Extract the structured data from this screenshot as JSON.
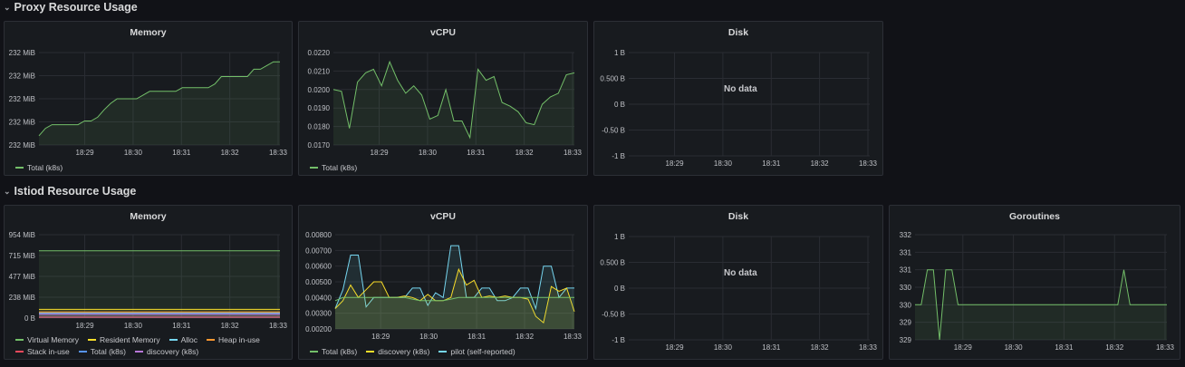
{
  "rows": [
    {
      "title": "Proxy Resource Usage"
    },
    {
      "title": "Istiod Resource Usage"
    }
  ],
  "colors": {
    "background": "#111217",
    "panel": "#181b1f",
    "green": "#73bf69",
    "yellow": "#fade2a",
    "cyan": "#8ab8ff",
    "lightblue": "#76d6f0",
    "orange": "#ff9830",
    "red": "#f2495c",
    "blue": "#5794f2",
    "purple": "#b877d9"
  },
  "panels": [
    {
      "title": "Memory",
      "legend": [
        {
          "label": "Total (k8s)",
          "color": "#73bf69"
        }
      ],
      "chart_data": {
        "type": "area",
        "x_ticks": [
          "18:29",
          "18:30",
          "18:31",
          "18:32",
          "18:33"
        ],
        "y_ticks": [
          "232 MiB",
          "232 MiB",
          "232 MiB",
          "232 MiB",
          "232 MiB"
        ],
        "series": [
          {
            "name": "Total (k8s)",
            "color": "#73bf69",
            "values": [
              0.1,
              0.18,
              0.22,
              0.22,
              0.22,
              0.22,
              0.22,
              0.26,
              0.26,
              0.3,
              0.38,
              0.45,
              0.5,
              0.5,
              0.5,
              0.5,
              0.54,
              0.58,
              0.58,
              0.58,
              0.58,
              0.58,
              0.62,
              0.62,
              0.62,
              0.62,
              0.62,
              0.66,
              0.74,
              0.74,
              0.74,
              0.74,
              0.74,
              0.82,
              0.82,
              0.86,
              0.9,
              0.9
            ]
          }
        ]
      }
    },
    {
      "title": "vCPU",
      "legend": [
        {
          "label": "Total (k8s)",
          "color": "#73bf69"
        }
      ],
      "chart_data": {
        "type": "area",
        "x_ticks": [
          "18:29",
          "18:30",
          "18:31",
          "18:32",
          "18:33"
        ],
        "y_ticks": [
          "0.0220",
          "0.0210",
          "0.0200",
          "0.0190",
          "0.0180",
          "0.0170"
        ],
        "ylim": [
          0.017,
          0.022
        ],
        "series": [
          {
            "name": "Total (k8s)",
            "color": "#73bf69",
            "values": [
              0.02,
              0.0199,
              0.0179,
              0.0204,
              0.0209,
              0.0211,
              0.0202,
              0.0215,
              0.0205,
              0.0198,
              0.0202,
              0.0197,
              0.0184,
              0.0186,
              0.02,
              0.0183,
              0.0183,
              0.0174,
              0.0211,
              0.0205,
              0.0207,
              0.0193,
              0.0191,
              0.0188,
              0.0182,
              0.0181,
              0.0192,
              0.0196,
              0.0198,
              0.0208,
              0.0209
            ]
          }
        ]
      }
    },
    {
      "title": "Disk",
      "no_data": "No data",
      "chart_data": {
        "type": "line",
        "x_ticks": [
          "18:29",
          "18:30",
          "18:31",
          "18:32",
          "18:33"
        ],
        "y_ticks": [
          "1 B",
          "0.500 B",
          "0 B",
          "-0.50 B",
          "-1 B"
        ],
        "series": []
      }
    },
    {
      "title": "Memory",
      "legend": [
        {
          "label": "Virtual Memory",
          "color": "#73bf69"
        },
        {
          "label": "Resident Memory",
          "color": "#fade2a"
        },
        {
          "label": "Alloc",
          "color": "#76d6f0"
        },
        {
          "label": "Heap in-use",
          "color": "#ff9830"
        },
        {
          "label": "Stack in-use",
          "color": "#f2495c"
        },
        {
          "label": "Total (k8s)",
          "color": "#5794f2"
        },
        {
          "label": "discovery (k8s)",
          "color": "#b877d9"
        }
      ],
      "chart_data": {
        "type": "area",
        "x_ticks": [
          "18:29",
          "18:30",
          "18:31",
          "18:32",
          "18:33"
        ],
        "y_ticks": [
          "954 MiB",
          "715 MiB",
          "477 MiB",
          "238 MiB",
          "0 B"
        ],
        "ylim": [
          0,
          954
        ],
        "series": [
          {
            "name": "Virtual Memory",
            "color": "#73bf69",
            "values": [
              770,
              770
            ]
          },
          {
            "name": "Resident Memory",
            "color": "#fade2a",
            "values": [
              100,
              100
            ]
          },
          {
            "name": "Alloc",
            "color": "#76d6f0",
            "values": [
              60,
              60
            ]
          },
          {
            "name": "Heap in-use",
            "color": "#ff9830",
            "values": [
              70,
              70
            ]
          },
          {
            "name": "Stack in-use",
            "color": "#f2495c",
            "values": [
              10,
              10
            ]
          },
          {
            "name": "Total (k8s)",
            "color": "#5794f2",
            "values": [
              50,
              50
            ]
          },
          {
            "name": "discovery (k8s)",
            "color": "#b877d9",
            "values": [
              45,
              45
            ]
          }
        ]
      }
    },
    {
      "title": "vCPU",
      "legend": [
        {
          "label": "Total (k8s)",
          "color": "#73bf69"
        },
        {
          "label": "discovery (k8s)",
          "color": "#fade2a"
        },
        {
          "label": "pilot (self-reported)",
          "color": "#76d6f0"
        }
      ],
      "chart_data": {
        "type": "area",
        "x_ticks": [
          "18:29",
          "18:30",
          "18:31",
          "18:32",
          "18:33"
        ],
        "y_ticks": [
          "0.00800",
          "0.00700",
          "0.00600",
          "0.00500",
          "0.00400",
          "0.00300",
          "0.00200"
        ],
        "ylim": [
          0.002,
          0.008
        ],
        "series": [
          {
            "name": "pilot (self-reported)",
            "color": "#76d6f0",
            "values": [
              0.0033,
              0.0045,
              0.0067,
              0.0067,
              0.0034,
              0.004,
              0.004,
              0.004,
              0.004,
              0.004,
              0.0046,
              0.0046,
              0.0035,
              0.0043,
              0.004,
              0.0073,
              0.0073,
              0.004,
              0.004,
              0.0046,
              0.0046,
              0.0038,
              0.0038,
              0.004,
              0.0046,
              0.0046,
              0.0033,
              0.006,
              0.006,
              0.004,
              0.0046,
              0.0046
            ]
          },
          {
            "name": "discovery (k8s)",
            "color": "#fade2a",
            "values": [
              0.0033,
              0.0038,
              0.0048,
              0.004,
              0.0045,
              0.005,
              0.005,
              0.004,
              0.004,
              0.0041,
              0.004,
              0.0038,
              0.0042,
              0.0038,
              0.0038,
              0.004,
              0.0058,
              0.0048,
              0.0051,
              0.004,
              0.0041,
              0.004,
              0.0041,
              0.004,
              0.004,
              0.0039,
              0.0028,
              0.0024,
              0.0047,
              0.0044,
              0.0046,
              0.0031
            ]
          },
          {
            "name": "Total (k8s)",
            "color": "#73bf69",
            "values": [
              0.0038,
              0.004,
              0.004,
              0.004,
              0.004,
              0.004,
              0.004,
              0.004,
              0.004,
              0.004,
              0.0039,
              0.0038,
              0.0038,
              0.0038,
              0.0038,
              0.0039,
              0.004,
              0.004,
              0.004,
              0.004,
              0.004,
              0.004,
              0.004,
              0.004,
              0.004,
              0.004,
              0.004,
              0.004,
              0.004,
              0.004,
              0.004,
              0.004
            ]
          }
        ]
      }
    },
    {
      "title": "Disk",
      "no_data": "No data",
      "chart_data": {
        "type": "line",
        "x_ticks": [
          "18:29",
          "18:30",
          "18:31",
          "18:32",
          "18:33"
        ],
        "y_ticks": [
          "1 B",
          "0.500 B",
          "0 B",
          "-0.50 B",
          "-1 B"
        ],
        "series": []
      }
    },
    {
      "title": "Goroutines",
      "chart_data": {
        "type": "area",
        "x_ticks": [
          "18:29",
          "18:30",
          "18:31",
          "18:32",
          "18:33"
        ],
        "y_ticks": [
          "332",
          "331",
          "331",
          "330",
          "330",
          "329",
          "329"
        ],
        "ylim": [
          329,
          332
        ],
        "series": [
          {
            "color": "#73bf69",
            "values": [
              330,
              330,
              331,
              331,
              329,
              331,
              331,
              330,
              330,
              330,
              330,
              330,
              330,
              330,
              330,
              330,
              330,
              330,
              330,
              330,
              330,
              330,
              330,
              330,
              330,
              330,
              330,
              330,
              330,
              330,
              330,
              330,
              330,
              330,
              331,
              330,
              330,
              330,
              330,
              330,
              330,
              330
            ]
          }
        ]
      }
    }
  ]
}
